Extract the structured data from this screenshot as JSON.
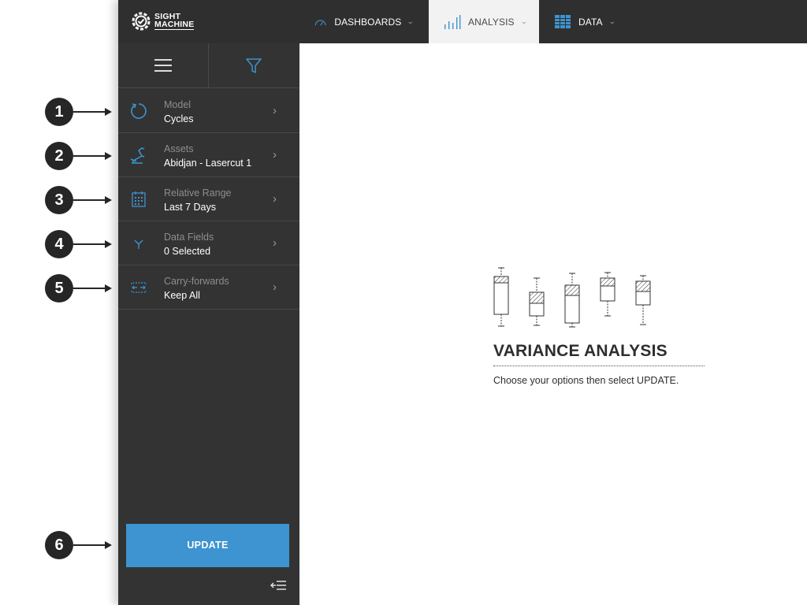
{
  "brand": {
    "line1": "SIGHT",
    "line2": "MACHINE"
  },
  "nav": {
    "dashboards": {
      "label": "DASHBOARDS",
      "icon": "speedometer-icon"
    },
    "analysis": {
      "label": "ANALYSIS",
      "icon": "bar-chart-icon",
      "active": true
    },
    "data": {
      "label": "DATA",
      "icon": "table-icon"
    }
  },
  "sidebar": {
    "options": [
      {
        "label": "Model",
        "value": "Cycles",
        "icon": "refresh-icon"
      },
      {
        "label": "Assets",
        "value": "Abidjan - Lasercut 1",
        "icon": "robot-arm-icon"
      },
      {
        "label": "Relative Range",
        "value": "Last 7 Days",
        "icon": "calendar-icon"
      },
      {
        "label": "Data Fields",
        "value": "0 Selected",
        "icon": "fork-icon"
      },
      {
        "label": "Carry-forwards",
        "value": "Keep All",
        "icon": "carry-forward-icon"
      }
    ],
    "update_label": "UPDATE"
  },
  "callouts": [
    "1",
    "2",
    "3",
    "4",
    "5",
    "6"
  ],
  "main": {
    "title": "VARIANCE ANALYSIS",
    "subtitle": "Choose your options then select UPDATE."
  },
  "colors": {
    "accent": "#3d94d0",
    "topbar": "#2f2f2f",
    "sidebar": "#333333",
    "active_tab": "#f2f2f2"
  }
}
